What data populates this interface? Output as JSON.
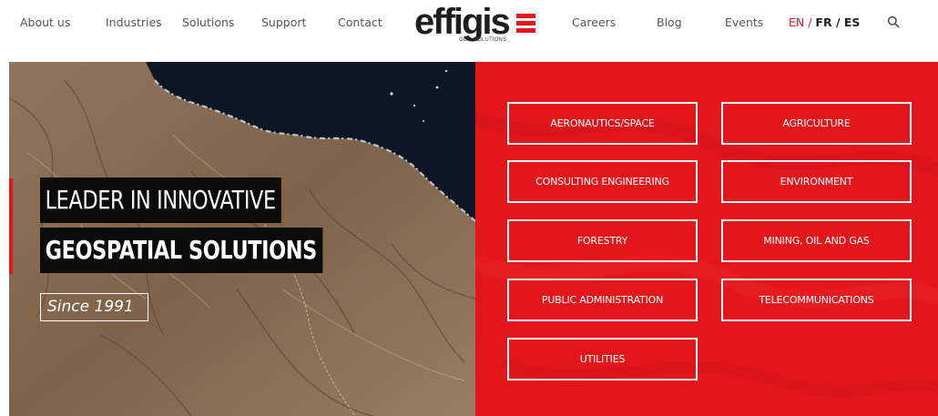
{
  "nav": {
    "left_links": [
      "About us",
      "Industries",
      "Solutions",
      "Support",
      "Contact"
    ],
    "right_links": [
      "Careers",
      "Blog",
      "Events"
    ],
    "languages": {
      "active": "EN",
      "others": [
        "FR",
        "ES"
      ],
      "separator": " / "
    }
  },
  "logo": {
    "word": "effigis",
    "tagline": "GEO SOLUTIONS"
  },
  "hero": {
    "headline_line1": "LEADER IN INNOVATIVE",
    "headline_line2": "GEOSPATIAL SOLUTIONS",
    "since": "Since 1991"
  },
  "industries": [
    "AERONAUTICS/SPACE",
    "AGRICULTURE",
    "CONSULTING ENGINEERING",
    "ENVIRONMENT",
    "FORESTRY",
    "MINING, OIL AND GAS",
    "PUBLIC ADMINISTRATION",
    "TELECOMMUNICATIONS",
    "UTILITIES"
  ],
  "colors": {
    "brand_red": "#e3161b",
    "nav_text": "#555555",
    "headline_bg": "#0c0c0c"
  },
  "icons": {
    "search": "search-icon"
  }
}
